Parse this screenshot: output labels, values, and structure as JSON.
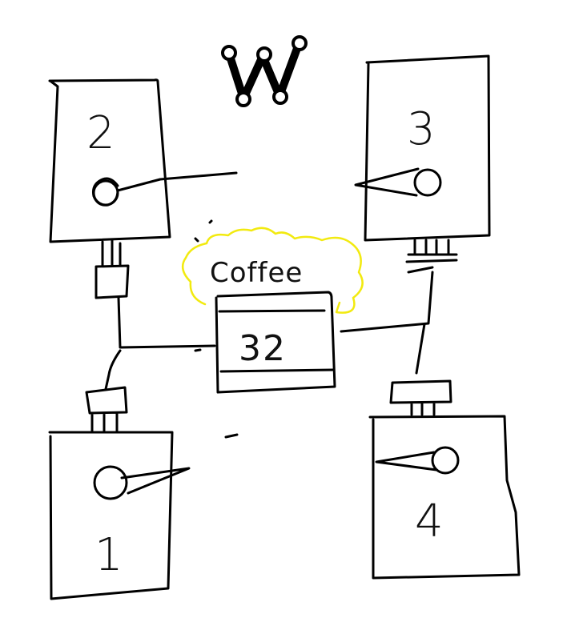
{
  "diagram": {
    "central_label": "Coffee",
    "central_number": "32",
    "stations": [
      {
        "id": "top-left",
        "number": "2"
      },
      {
        "id": "top-right",
        "number": "3"
      },
      {
        "id": "bottom-left",
        "number": "1"
      },
      {
        "id": "bottom-right",
        "number": "4"
      }
    ]
  },
  "logo": {
    "icon": "w-logo-icon"
  },
  "colors": {
    "ink": "#000000",
    "cloud": "#f2ea10",
    "background": "#ffffff"
  }
}
